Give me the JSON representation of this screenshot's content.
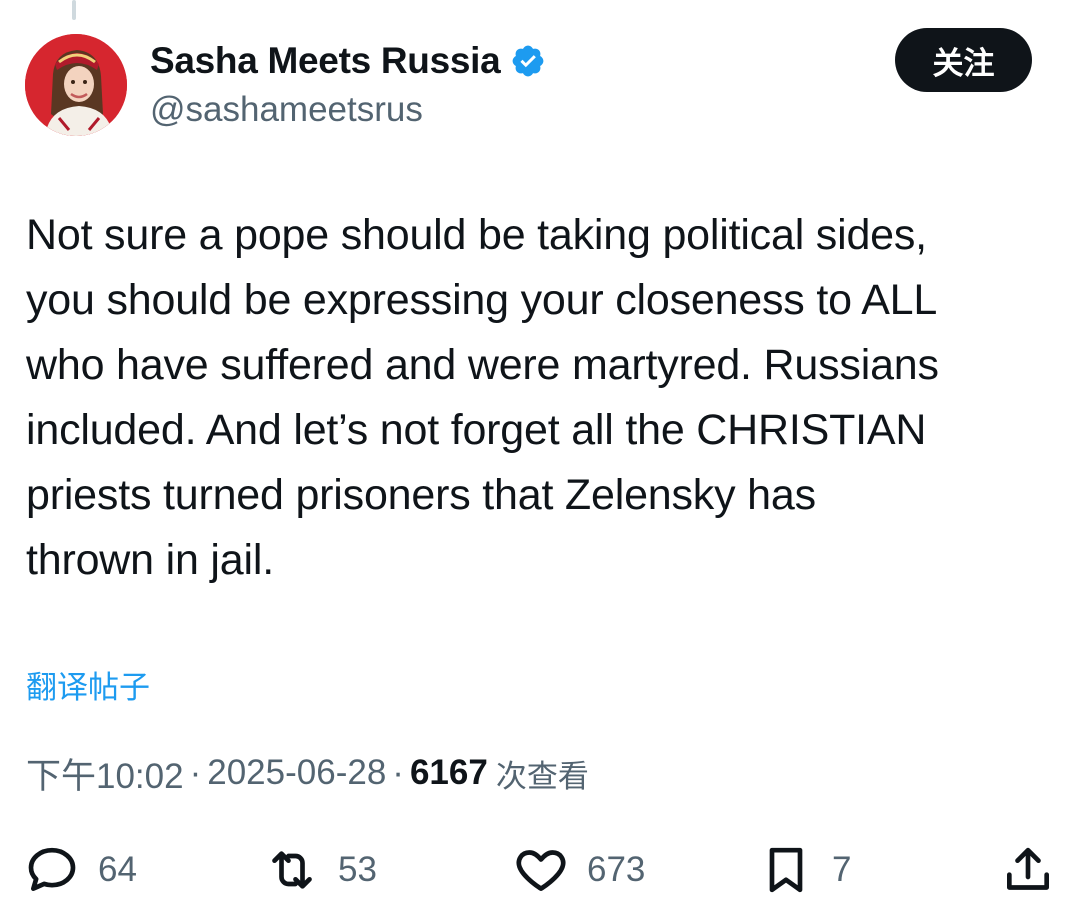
{
  "author": {
    "display_name": "Sasha Meets Russia",
    "handle": "@sashameetsrus",
    "verified": true,
    "avatar_icon": "profile-photo"
  },
  "follow_button": {
    "label": "关注"
  },
  "tweet": {
    "lines": [
      "Not sure a pope should be taking political sides,",
      "you should be expressing your closeness to ALL",
      "who have suffered and were martyred. Russians",
      "included. And let’s not forget all the CHRISTIAN",
      "priests turned prisoners that Zelensky has",
      "thrown in jail."
    ]
  },
  "translate_link": "翻译帖子",
  "meta": {
    "time": "下午10:02",
    "separator": "·",
    "date": "2025-06-28",
    "views_count": "6167",
    "views_label": "次查看"
  },
  "actions": {
    "reply": {
      "icon": "reply-icon",
      "count": "64"
    },
    "repost": {
      "icon": "repost-icon",
      "count": "53"
    },
    "like": {
      "icon": "heart-icon",
      "count": "673"
    },
    "bookmark": {
      "icon": "bookmark-icon",
      "count": "7"
    },
    "share": {
      "icon": "share-icon"
    }
  },
  "colors": {
    "text": "#0f1419",
    "secondary": "#536471",
    "link": "#1d9bf0",
    "verified_badge": "#1d9bf0",
    "follow_bg": "#0f1419",
    "avatar_bg": "#d6262f"
  }
}
